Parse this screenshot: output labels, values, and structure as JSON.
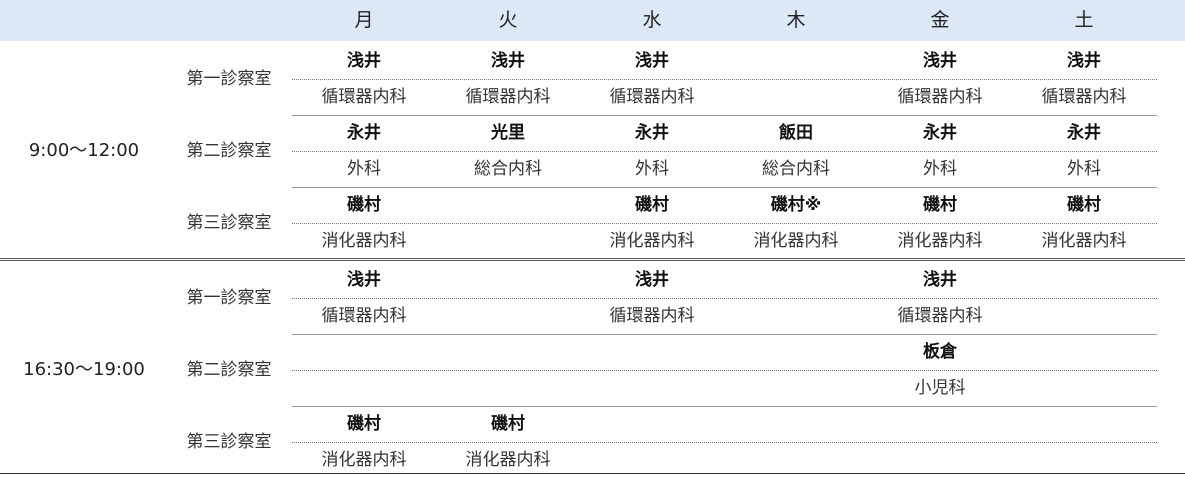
{
  "days": [
    "月",
    "火",
    "水",
    "木",
    "金",
    "土"
  ],
  "sessions": [
    {
      "time": "9:00～12:00",
      "rooms": [
        {
          "name": "第一診察室",
          "slots": [
            {
              "doctor": "浅井",
              "dept": "循環器内科"
            },
            {
              "doctor": "浅井",
              "dept": "循環器内科"
            },
            {
              "doctor": "浅井",
              "dept": "循環器内科"
            },
            {
              "doctor": "",
              "dept": ""
            },
            {
              "doctor": "浅井",
              "dept": "循環器内科"
            },
            {
              "doctor": "浅井",
              "dept": "循環器内科"
            }
          ]
        },
        {
          "name": "第二診察室",
          "slots": [
            {
              "doctor": "永井",
              "dept": "外科"
            },
            {
              "doctor": "光里",
              "dept": "総合内科"
            },
            {
              "doctor": "永井",
              "dept": "外科"
            },
            {
              "doctor": "飯田",
              "dept": "総合内科"
            },
            {
              "doctor": "永井",
              "dept": "外科"
            },
            {
              "doctor": "永井",
              "dept": "外科"
            }
          ]
        },
        {
          "name": "第三診察室",
          "slots": [
            {
              "doctor": "磯村",
              "dept": "消化器内科"
            },
            {
              "doctor": "",
              "dept": ""
            },
            {
              "doctor": "磯村",
              "dept": "消化器内科"
            },
            {
              "doctor": "磯村※",
              "dept": "消化器内科"
            },
            {
              "doctor": "磯村",
              "dept": "消化器内科"
            },
            {
              "doctor": "磯村",
              "dept": "消化器内科"
            }
          ]
        }
      ]
    },
    {
      "time": "16:30～19:00",
      "rooms": [
        {
          "name": "第一診察室",
          "slots": [
            {
              "doctor": "浅井",
              "dept": "循環器内科"
            },
            {
              "doctor": "",
              "dept": ""
            },
            {
              "doctor": "浅井",
              "dept": "循環器内科"
            },
            {
              "doctor": "",
              "dept": ""
            },
            {
              "doctor": "浅井",
              "dept": "循環器内科"
            },
            {
              "doctor": "",
              "dept": ""
            }
          ]
        },
        {
          "name": "第二診察室",
          "slots": [
            {
              "doctor": "",
              "dept": ""
            },
            {
              "doctor": "",
              "dept": ""
            },
            {
              "doctor": "",
              "dept": ""
            },
            {
              "doctor": "",
              "dept": ""
            },
            {
              "doctor": "板倉",
              "dept": "小児科"
            },
            {
              "doctor": "",
              "dept": ""
            }
          ]
        },
        {
          "name": "第三診察室",
          "slots": [
            {
              "doctor": "磯村",
              "dept": "消化器内科"
            },
            {
              "doctor": "磯村",
              "dept": "消化器内科"
            },
            {
              "doctor": "",
              "dept": ""
            },
            {
              "doctor": "",
              "dept": ""
            },
            {
              "doctor": "",
              "dept": ""
            },
            {
              "doctor": "",
              "dept": ""
            }
          ]
        }
      ]
    }
  ],
  "colors": {
    "header_bg": "#dde8f6"
  }
}
